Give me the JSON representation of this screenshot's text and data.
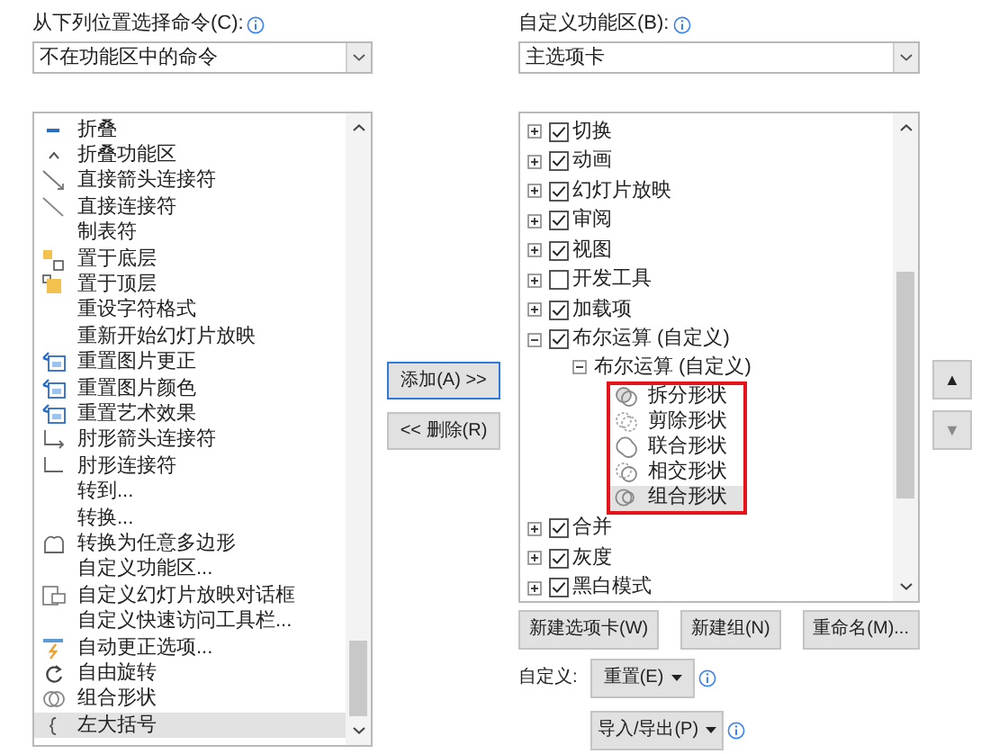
{
  "left": {
    "label": "从下列位置选择命令(C):",
    "dropdown": {
      "value": "不在功能区中的命令"
    },
    "items": [
      {
        "label": "折叠",
        "kind": "minus",
        "selected": false
      },
      {
        "label": "折叠功能区",
        "kind": "caret",
        "selected": false
      },
      {
        "label": "直接箭头连接符",
        "kind": "arrow-line",
        "selected": false
      },
      {
        "label": "直接连接符",
        "kind": "line",
        "selected": false
      },
      {
        "label": "制表符",
        "kind": "plain",
        "selected": false
      },
      {
        "label": "置于底层",
        "kind": "send-back",
        "selected": false
      },
      {
        "label": "置于顶层",
        "kind": "bring-front",
        "selected": false
      },
      {
        "label": "重设字符格式",
        "kind": "plain",
        "selected": false
      },
      {
        "label": "重新开始幻灯片放映",
        "kind": "plain",
        "selected": false
      },
      {
        "label": "重置图片更正",
        "kind": "reset-picture",
        "selected": false
      },
      {
        "label": "重置图片颜色",
        "kind": "reset-picture",
        "selected": false
      },
      {
        "label": "重置艺术效果",
        "kind": "reset-picture",
        "selected": false
      },
      {
        "label": "肘形箭头连接符",
        "kind": "elbow-arrow",
        "selected": false
      },
      {
        "label": "肘形连接符",
        "kind": "elbow",
        "selected": false
      },
      {
        "label": "转到...",
        "kind": "plain",
        "selected": false
      },
      {
        "label": "转换...",
        "kind": "plain",
        "selected": false
      },
      {
        "label": "转换为任意多边形",
        "kind": "freeform",
        "selected": false
      },
      {
        "label": "自定义功能区...",
        "kind": "plain",
        "selected": false
      },
      {
        "label": "自定义幻灯片放映对话框",
        "kind": "dialog",
        "selected": false
      },
      {
        "label": "自定义快速访问工具栏...",
        "kind": "plain",
        "selected": false
      },
      {
        "label": "自动更正选项...",
        "kind": "autocorrect",
        "selected": false
      },
      {
        "label": "自由旋转",
        "kind": "rotate",
        "selected": false
      },
      {
        "label": "组合形状",
        "kind": "shape-combine",
        "selected": false
      },
      {
        "label": "左大括号",
        "kind": "brace",
        "selected": true
      }
    ]
  },
  "middle_buttons": [
    {
      "label": "添加(A) >>",
      "focused": true,
      "disabled": false
    },
    {
      "label": "<< 删除(R)",
      "focused": false,
      "disabled": false
    }
  ],
  "right": {
    "label": "自定义功能区(B):",
    "dropdown": {
      "value": "主选项卡"
    },
    "tree": [
      {
        "label": "切换",
        "checked": true,
        "expanded": false
      },
      {
        "label": "动画",
        "checked": true,
        "expanded": false
      },
      {
        "label": "幻灯片放映",
        "checked": true,
        "expanded": false
      },
      {
        "label": "审阅",
        "checked": true,
        "expanded": false
      },
      {
        "label": "视图",
        "checked": true,
        "expanded": false
      },
      {
        "label": "开发工具",
        "checked": false,
        "expanded": false
      },
      {
        "label": "加载项",
        "checked": true,
        "expanded": false
      },
      {
        "label": "布尔运算 (自定义)",
        "checked": true,
        "expanded": true,
        "children": [
          {
            "label": "布尔运算 (自定义)",
            "expanded": true,
            "highlighted": true,
            "children": [
              {
                "label": "拆分形状",
                "kind": "split",
                "selected": false
              },
              {
                "label": "剪除形状",
                "kind": "subtract",
                "selected": false
              },
              {
                "label": "联合形状",
                "kind": "union",
                "selected": false
              },
              {
                "label": "相交形状",
                "kind": "intersect",
                "selected": false
              },
              {
                "label": "组合形状",
                "kind": "combine",
                "selected": true
              }
            ]
          }
        ]
      },
      {
        "label": "合并",
        "checked": true,
        "expanded": false
      },
      {
        "label": "灰度",
        "checked": true,
        "expanded": false
      },
      {
        "label": "黑白模式",
        "checked": true,
        "expanded": false
      }
    ],
    "buttons": [
      "新建选项卡(W)",
      "新建组(N)",
      "重命名(M)..."
    ],
    "customize_label": "自定义:",
    "reset_button": "重置(E)",
    "import_export_button": "导入/导出(P)",
    "move_buttons": [
      {
        "label": "▲",
        "disabled": false
      },
      {
        "label": "▼",
        "disabled": true
      }
    ]
  }
}
